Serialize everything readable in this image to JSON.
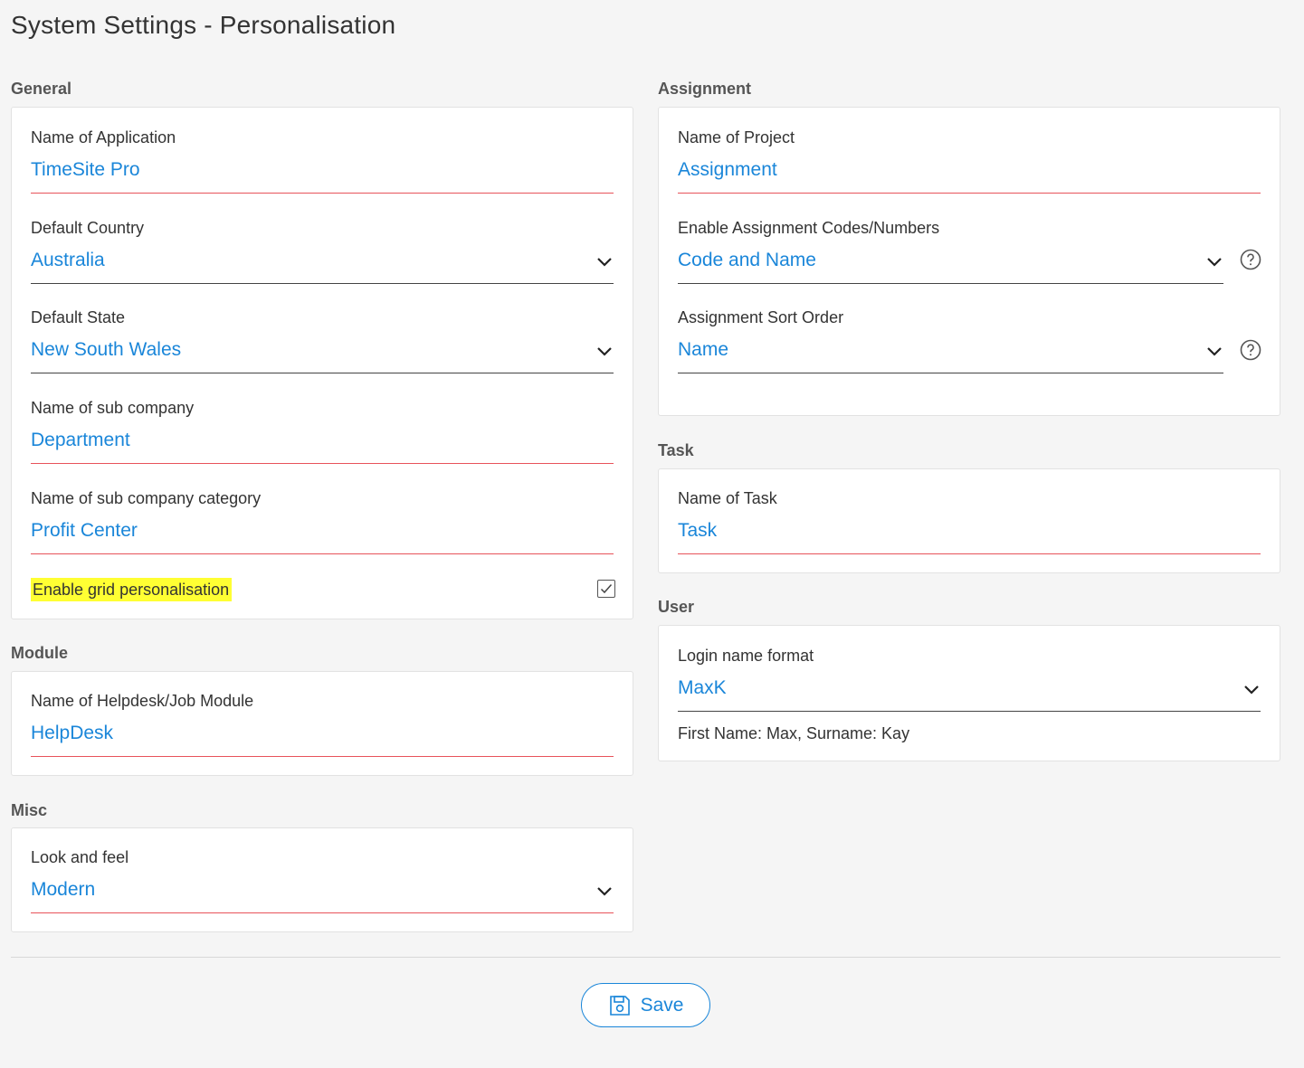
{
  "page": {
    "title": "System Settings - Personalisation"
  },
  "general": {
    "heading": "General",
    "application_name": {
      "label": "Name of Application",
      "value": "TimeSite Pro"
    },
    "default_country": {
      "label": "Default Country",
      "value": "Australia"
    },
    "default_state": {
      "label": "Default State",
      "value": "New South Wales"
    },
    "sub_company": {
      "label": "Name of sub company",
      "value": "Department"
    },
    "sub_company_category": {
      "label": "Name of sub company category",
      "value": "Profit Center"
    },
    "grid_personalisation": {
      "label": "Enable grid personalisation",
      "checked": true
    }
  },
  "module": {
    "heading": "Module",
    "helpdesk_module": {
      "label": "Name of Helpdesk/Job Module",
      "value": "HelpDesk"
    }
  },
  "misc": {
    "heading": "Misc",
    "look_and_feel": {
      "label": "Look and feel",
      "value": "Modern"
    }
  },
  "assignment": {
    "heading": "Assignment",
    "project_name": {
      "label": "Name of Project",
      "value": "Assignment"
    },
    "codes_numbers": {
      "label": "Enable Assignment Codes/Numbers",
      "value": "Code and Name"
    },
    "sort_order": {
      "label": "Assignment Sort Order",
      "value": "Name"
    }
  },
  "task": {
    "heading": "Task",
    "task_name": {
      "label": "Name of Task",
      "value": "Task"
    }
  },
  "user": {
    "heading": "User",
    "login_format": {
      "label": "Login name format",
      "value": "MaxK",
      "hint": "First Name: Max, Surname: Kay"
    }
  },
  "actions": {
    "save_label": "Save"
  },
  "colors": {
    "accent": "#1a86d9",
    "underline_text": "#e8535a",
    "highlight": "#ffff33"
  },
  "icons": [
    "chevron-down-icon",
    "help-icon",
    "checkbox-check-icon",
    "save-disk-icon"
  ]
}
